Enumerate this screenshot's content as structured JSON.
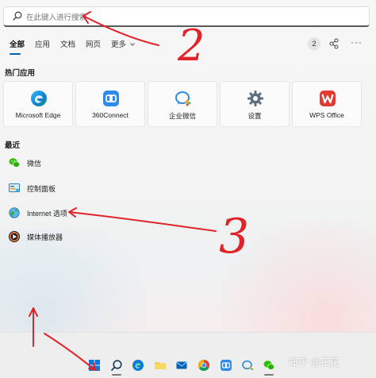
{
  "search": {
    "placeholder": "在此键入进行搜索"
  },
  "tabs": [
    {
      "label": "全部",
      "active": true
    },
    {
      "label": "应用"
    },
    {
      "label": "文档"
    },
    {
      "label": "网页"
    },
    {
      "label": "更多"
    }
  ],
  "header": {
    "badge_count": "2"
  },
  "pinned": {
    "title": "热门应用",
    "apps": [
      {
        "label": "Microsoft Edge",
        "icon": "edge-icon"
      },
      {
        "label": "360Connect",
        "icon": "360connect-icon"
      },
      {
        "label": "企业微信",
        "icon": "wecom-icon"
      },
      {
        "label": "设置",
        "icon": "settings-gear-icon"
      },
      {
        "label": "WPS Office",
        "icon": "wps-office-icon"
      }
    ]
  },
  "recent": {
    "title": "最近",
    "items": [
      {
        "label": "微信",
        "icon": "wechat-icon"
      },
      {
        "label": "控制面板",
        "icon": "control-panel-icon"
      },
      {
        "label": "Internet 选项",
        "icon": "internet-options-icon"
      },
      {
        "label": "媒体播放器",
        "icon": "media-player-icon"
      }
    ]
  },
  "annotations": [
    "2",
    "3"
  ],
  "watermark": "知乎 @花花",
  "colors": {
    "accent": "#005fb8",
    "annotation_red": "#e0242a",
    "wps_red": "#e23b32",
    "edge_blue": "#0f7bd7"
  }
}
